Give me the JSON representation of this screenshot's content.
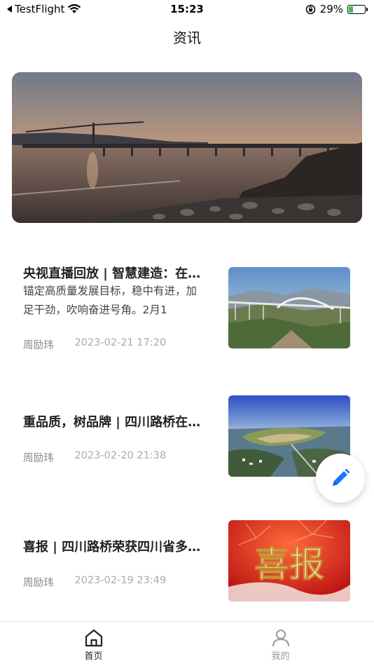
{
  "status_bar": {
    "back_app": "TestFlight",
    "time": "15:23",
    "battery": "29%",
    "battery_level": 0.29
  },
  "nav": {
    "title": "资讯"
  },
  "banner": {
    "icon": "river-bridge-sunset-photo"
  },
  "news": [
    {
      "title": "央视直播回放 | 智慧建造：在秦巴山区看“超级工程”",
      "summary": "锚定高质量发展目标，稳中有进，加足干劲，吹响奋进号角。2月1",
      "author": "周励玮",
      "date": "2023-02-21 17:20",
      "thumb": "arch-bridge-valley-photo"
    },
    {
      "title": "重品质，树品牌 | 四川路桥在行动",
      "summary": "",
      "author": "周励玮",
      "date": "2023-02-20 21:38",
      "thumb": "aerial-city-river-photo"
    },
    {
      "title": "喜报 | 四川路桥荣获四川省多项荣誉",
      "summary": "",
      "author": "周励玮",
      "date": "2023-02-19 23:49",
      "thumb": "red-celebration-banner",
      "thumb_text": "喜报"
    }
  ],
  "fab": {
    "icon": "pencil-icon"
  },
  "tabs": [
    {
      "label": "首页",
      "icon": "home-icon",
      "active": true
    },
    {
      "label": "我的",
      "icon": "user-icon",
      "active": false
    }
  ],
  "colors": {
    "accent": "#1677ff",
    "text": "#222222",
    "muted": "#aaaaaa"
  }
}
